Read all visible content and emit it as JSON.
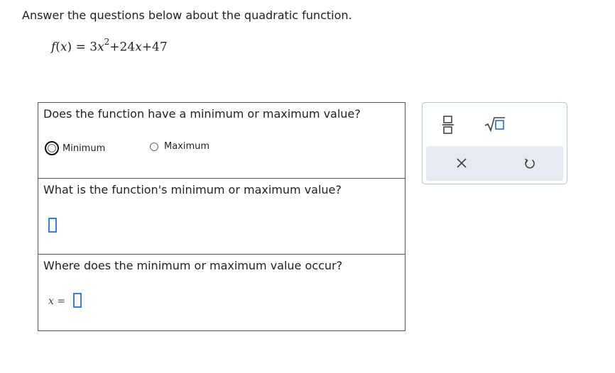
{
  "instructions": "Answer the questions below about the quadratic function.",
  "formula": {
    "fname": "f",
    "var": "x",
    "equals": "=",
    "coef_a": "3",
    "x2": "x",
    "exp": "2",
    "op1": "+",
    "coef_b": "24",
    "x1": "x",
    "op2": "+",
    "const": "47"
  },
  "questions": {
    "q1": {
      "text": "Does the function have a minimum or maximum value?",
      "options": [
        "Minimum",
        "Maximum"
      ],
      "selected": ""
    },
    "q2": {
      "text": "What is the function's minimum or maximum value?",
      "answer": ""
    },
    "q3": {
      "text": "Where does the minimum or maximum value occur?",
      "var": "x",
      "equals": "=",
      "answer": ""
    }
  },
  "toolbar": {
    "icons": [
      "fraction-icon",
      "sqrt-icon",
      "clear-icon",
      "undo-icon"
    ],
    "accent": "#3b7dd8"
  }
}
